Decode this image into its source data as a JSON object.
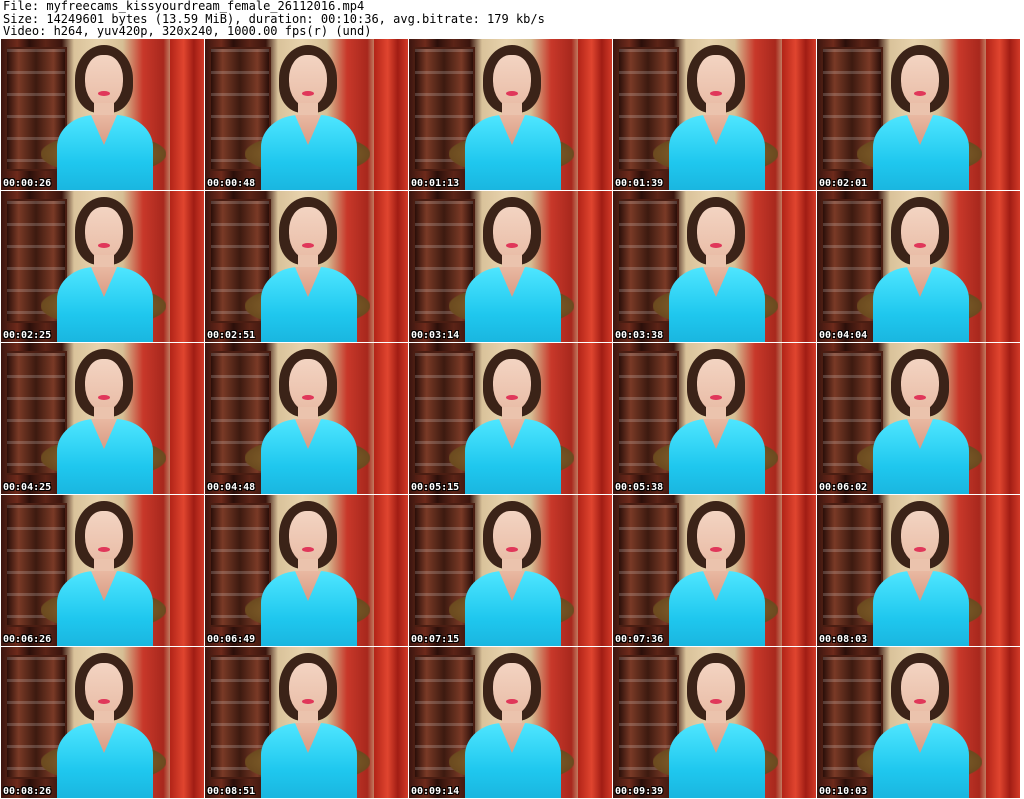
{
  "header": {
    "file_line": "File: myfreecams_kissyourdream_female_26112016.mp4",
    "size_line": "Size: 14249601 bytes (13.59 MiB), duration: 00:10:36, avg.bitrate: 179 kb/s",
    "video_line": "Video: h264, yuv420p, 320x240, 1000.00 fps(r) (und)"
  },
  "thumbnails": [
    {
      "timestamp": "00:00:26"
    },
    {
      "timestamp": "00:00:48"
    },
    {
      "timestamp": "00:01:13"
    },
    {
      "timestamp": "00:01:39"
    },
    {
      "timestamp": "00:02:01"
    },
    {
      "timestamp": "00:02:25"
    },
    {
      "timestamp": "00:02:51"
    },
    {
      "timestamp": "00:03:14"
    },
    {
      "timestamp": "00:03:38"
    },
    {
      "timestamp": "00:04:04"
    },
    {
      "timestamp": "00:04:25"
    },
    {
      "timestamp": "00:04:48"
    },
    {
      "timestamp": "00:05:15"
    },
    {
      "timestamp": "00:05:38"
    },
    {
      "timestamp": "00:06:02"
    },
    {
      "timestamp": "00:06:26"
    },
    {
      "timestamp": "00:06:49"
    },
    {
      "timestamp": "00:07:15"
    },
    {
      "timestamp": "00:07:36"
    },
    {
      "timestamp": "00:08:03"
    },
    {
      "timestamp": "00:08:26"
    },
    {
      "timestamp": "00:08:51"
    },
    {
      "timestamp": "00:09:14"
    },
    {
      "timestamp": "00:09:39"
    },
    {
      "timestamp": "00:10:03"
    }
  ]
}
